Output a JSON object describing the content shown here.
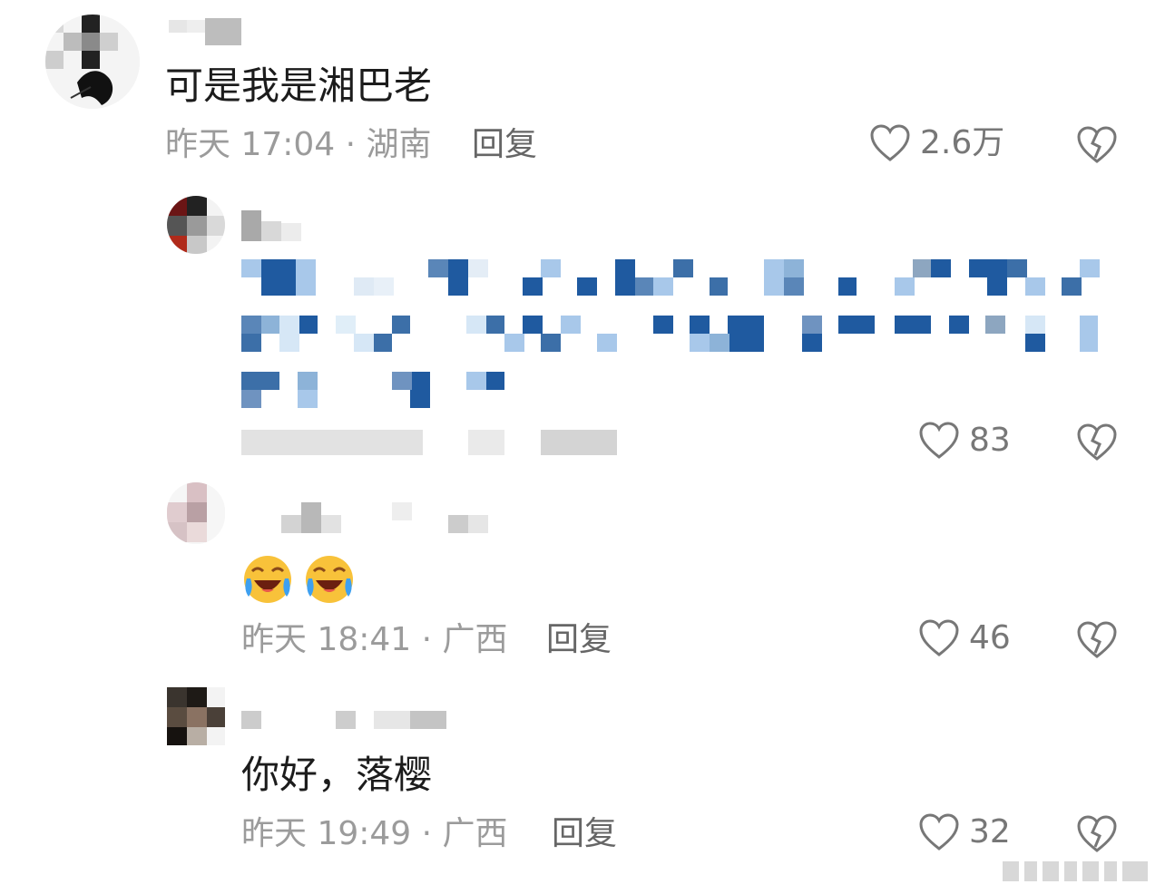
{
  "comments": [
    {
      "text": "可是我是湘巴老",
      "meta": "昨天 17:04 · 湖南",
      "reply": "回复",
      "likes": "2.6万"
    },
    {
      "text": "",
      "meta": "",
      "reply": "",
      "likes": "83"
    },
    {
      "text": "",
      "meta": "昨天 18:41 · 广西",
      "reply": "回复",
      "likes": "46",
      "emoji": [
        "rofl-emoji",
        "rofl-emoji"
      ]
    },
    {
      "text": "你好，落樱",
      "meta": "昨天 19:49 · 广西",
      "reply": "回复",
      "likes": "32"
    }
  ],
  "colors": {
    "meta_gray": "#9b9b9b",
    "like_gray": "#777777",
    "mosaic_blue": "#1f5aa0",
    "mosaic_light": "#a8c8ea"
  }
}
